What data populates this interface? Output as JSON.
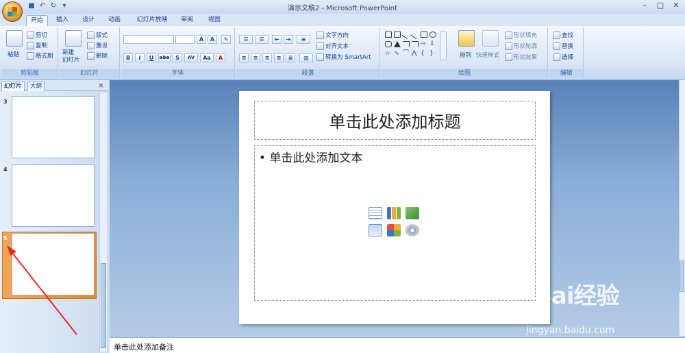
{
  "window": {
    "title": "演示文稿2 - Microsoft PowerPoint"
  },
  "tabs": [
    {
      "label": "开始"
    },
    {
      "label": "插入"
    },
    {
      "label": "设计"
    },
    {
      "label": "动画"
    },
    {
      "label": "幻灯片放映"
    },
    {
      "label": "审阅"
    },
    {
      "label": "视图"
    }
  ],
  "ribbon": {
    "clipboard": {
      "label": "剪贴板",
      "paste": "粘贴",
      "cut": "剪切",
      "copy": "复制",
      "format_painter": "格式刷"
    },
    "slides": {
      "label": "幻灯片",
      "new_slide": "新建\n幻灯片",
      "layout": "版式",
      "reset": "重设",
      "delete": "删除"
    },
    "font": {
      "label": "字体",
      "bold": "B",
      "italic": "I",
      "underline": "U",
      "strike": "abe",
      "shadow": "S",
      "spacing": "AV",
      "case": "Aa",
      "color": "A"
    },
    "paragraph": {
      "label": "段落",
      "text_direction": "文字方向",
      "align_text": "对齐文本",
      "smartart": "转换为 SmartArt"
    },
    "drawing": {
      "label": "绘图",
      "arrange": "排列",
      "quick_styles": "快速样式",
      "shape_fill": "形状填充",
      "shape_outline": "形状轮廓",
      "shape_effects": "形状效果"
    },
    "editing": {
      "label": "编辑",
      "find": "查找",
      "replace": "替换",
      "select": "选择"
    }
  },
  "pane": {
    "tab_slides": "幻灯片",
    "tab_outline": "大纲",
    "close": "×",
    "thumbs": [
      {
        "num": "3"
      },
      {
        "num": "4"
      },
      {
        "num": "5"
      }
    ]
  },
  "slide": {
    "title_placeholder": "单击此处添加标题",
    "body_placeholder": "单击此处添加文本",
    "bullet": "•"
  },
  "notes": {
    "placeholder": "单击此处添加备注"
  },
  "watermark": {
    "brand": "Bai经验",
    "url": "jingyan.baidu.com"
  },
  "colors": {
    "selection": "#e58826",
    "accent": "#15428b"
  }
}
